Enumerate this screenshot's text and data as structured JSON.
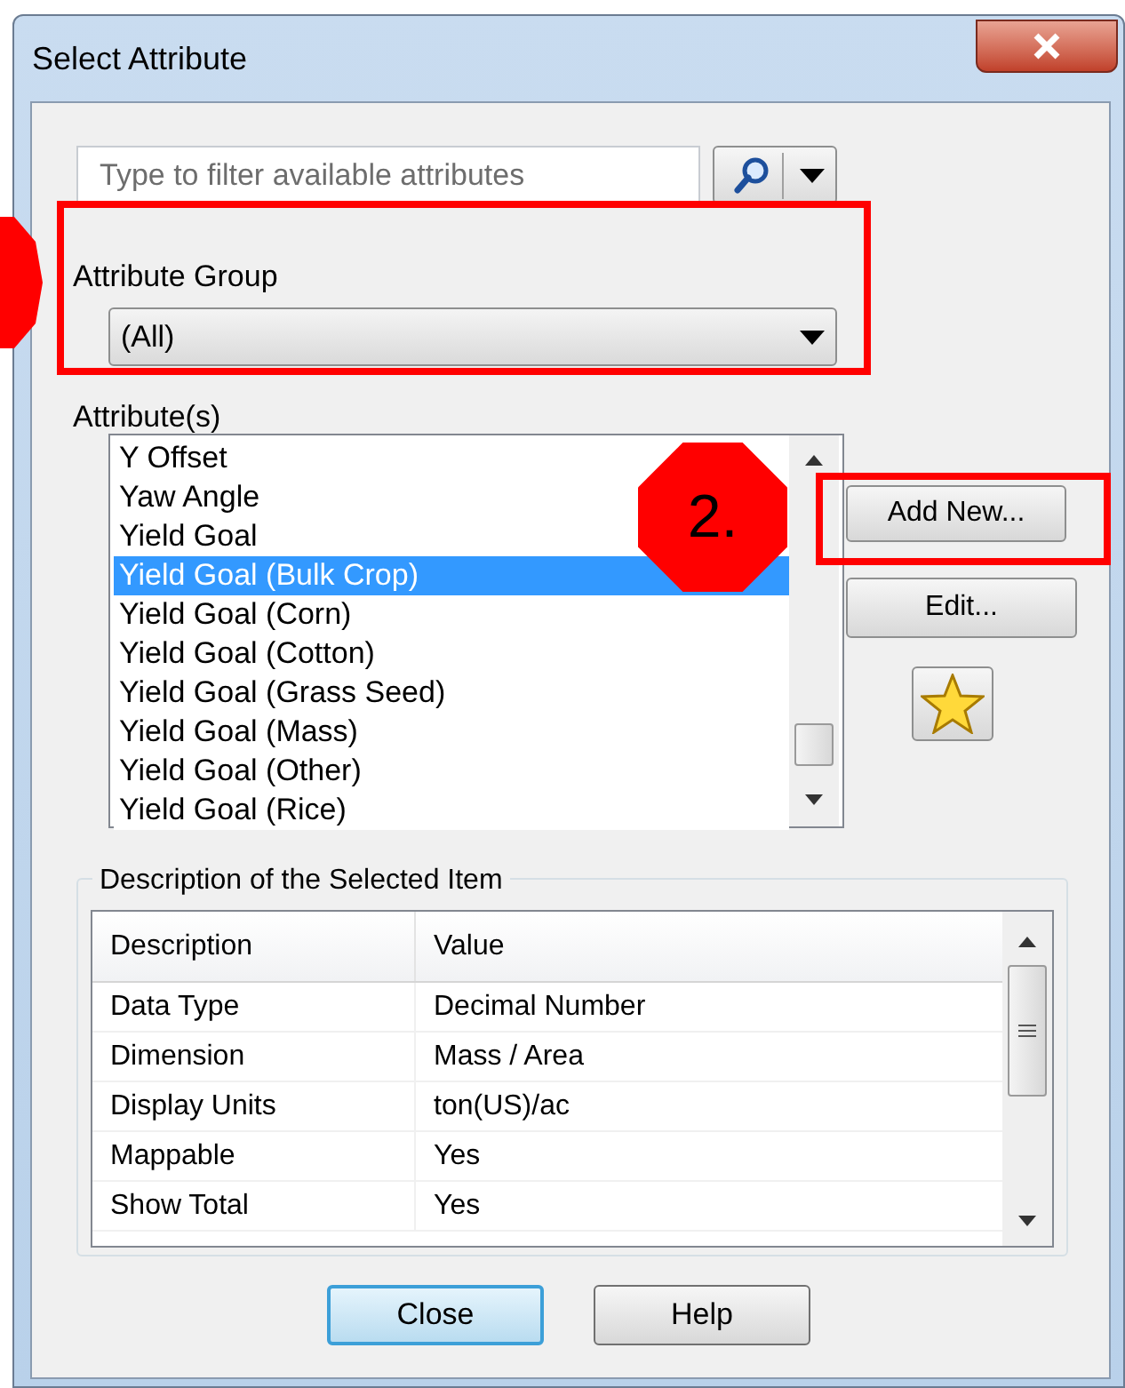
{
  "window": {
    "title": "Select Attribute"
  },
  "filter": {
    "placeholder": "Type to filter available attributes"
  },
  "attribute_group": {
    "label": "Attribute Group",
    "value": "(All)"
  },
  "attributes": {
    "label": "Attribute(s)",
    "items": [
      {
        "label": "Y Offset",
        "selected": false
      },
      {
        "label": "Yaw Angle",
        "selected": false
      },
      {
        "label": "Yield Goal",
        "selected": false
      },
      {
        "label": "Yield Goal (Bulk Crop)",
        "selected": true
      },
      {
        "label": "Yield Goal (Corn)",
        "selected": false
      },
      {
        "label": "Yield Goal (Cotton)",
        "selected": false
      },
      {
        "label": "Yield Goal (Grass Seed)",
        "selected": false
      },
      {
        "label": "Yield Goal (Mass)",
        "selected": false
      },
      {
        "label": "Yield Goal (Other)",
        "selected": false
      },
      {
        "label": "Yield Goal (Rice)",
        "selected": false
      }
    ]
  },
  "side_buttons": [
    "Add New...",
    "Edit..."
  ],
  "description": {
    "title": "Description of the Selected Item",
    "columns": [
      "Description",
      "Value"
    ],
    "rows": [
      [
        "Data Type",
        "Decimal Number"
      ],
      [
        "Dimension",
        "Mass / Area"
      ],
      [
        "Display Units",
        "ton(US)/ac"
      ],
      [
        "Mappable",
        "Yes"
      ],
      [
        "Show Total",
        "Yes"
      ]
    ]
  },
  "buttons": [
    {
      "label": "Close",
      "default": true
    },
    {
      "label": "Help",
      "default": false
    }
  ],
  "annotations": {
    "callout": "2."
  }
}
